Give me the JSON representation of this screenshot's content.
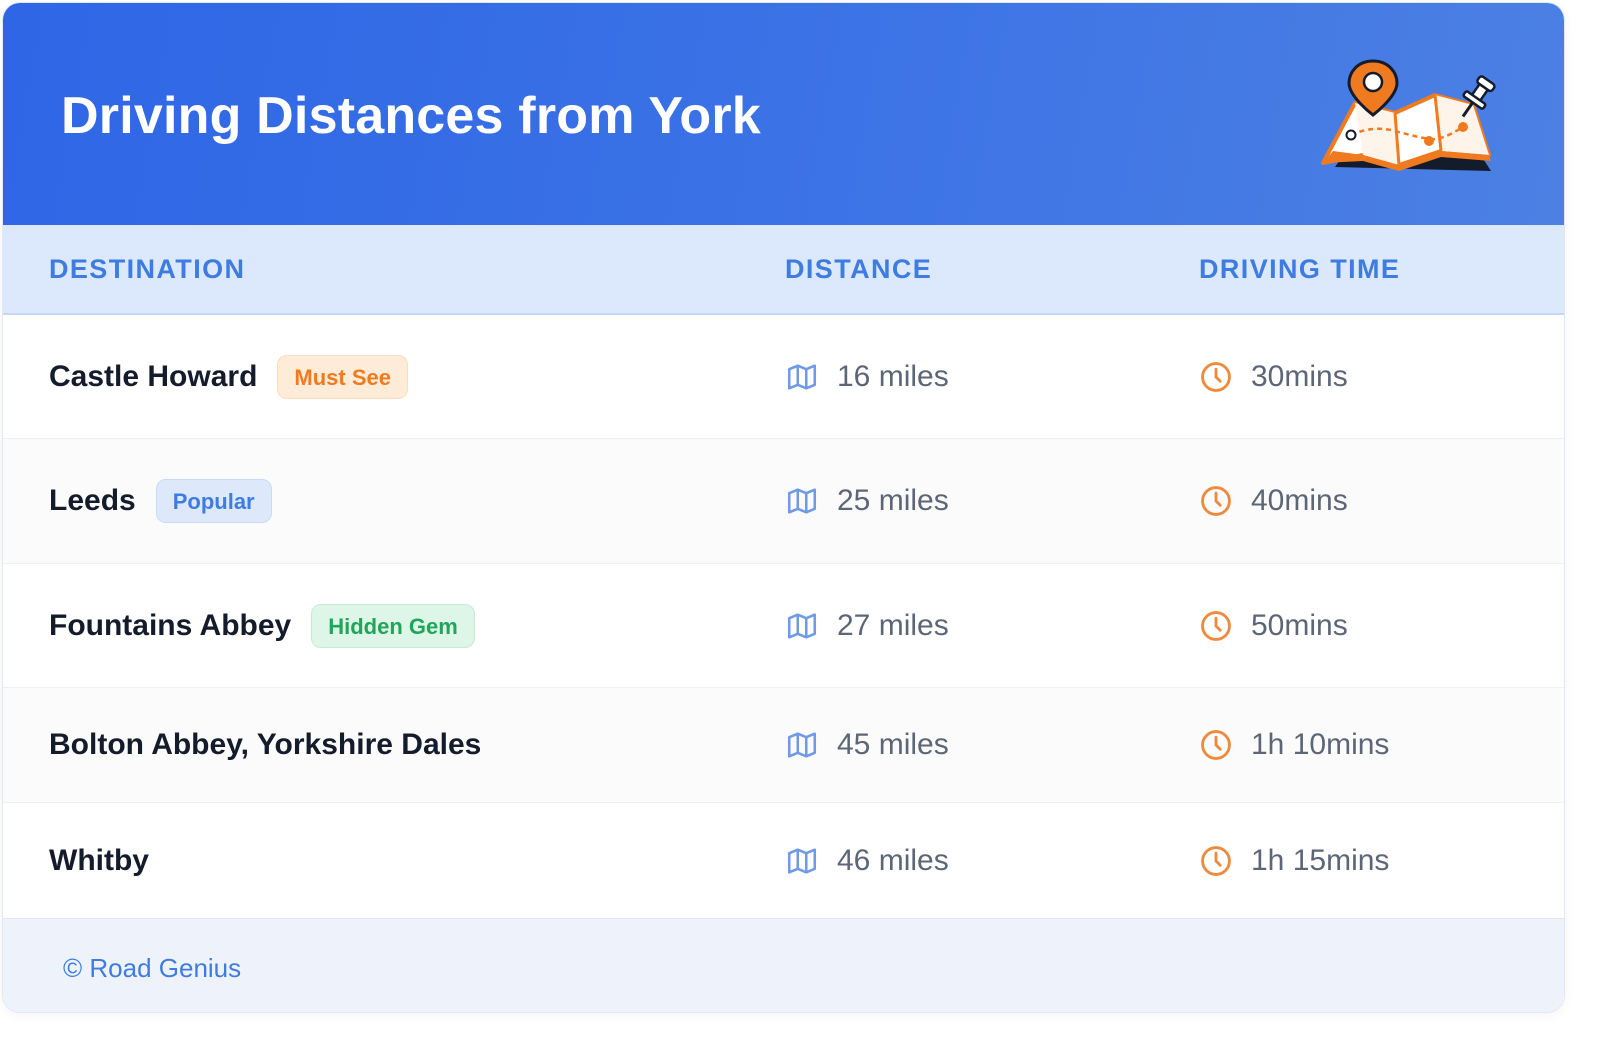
{
  "header": {
    "title": "Driving Distances from York"
  },
  "table": {
    "columns": [
      "DESTINATION",
      "DISTANCE",
      "DRIVING TIME"
    ],
    "rows": [
      {
        "destination": "Castle Howard",
        "badge": "Must See",
        "badge_tone": "orange",
        "distance": "16 miles",
        "time": "30mins"
      },
      {
        "destination": "Leeds",
        "badge": "Popular",
        "badge_tone": "blue",
        "distance": "25 miles",
        "time": "40mins"
      },
      {
        "destination": "Fountains Abbey",
        "badge": "Hidden Gem",
        "badge_tone": "green",
        "distance": "27 miles",
        "time": "50mins"
      },
      {
        "destination": "Bolton Abbey, Yorkshire Dales",
        "badge": null,
        "badge_tone": null,
        "distance": "45 miles",
        "time": "1h 10mins"
      },
      {
        "destination": "Whitby",
        "badge": null,
        "badge_tone": null,
        "distance": "46 miles",
        "time": "1h 15mins"
      }
    ]
  },
  "icons": {
    "distance": "map-icon",
    "time": "clock-icon",
    "header": "map-pin-illustration"
  },
  "footer": {
    "text": "© Road Genius"
  },
  "colors": {
    "header_gradient_start": "#2e66e6",
    "header_gradient_end": "#4c80e3",
    "accent_blue": "#3f7ce0",
    "badge_orange": "#ef7a1f",
    "badge_green": "#21a55b",
    "clock_orange": "#ef8a3d",
    "map_icon_blue": "#6f9ae6"
  }
}
